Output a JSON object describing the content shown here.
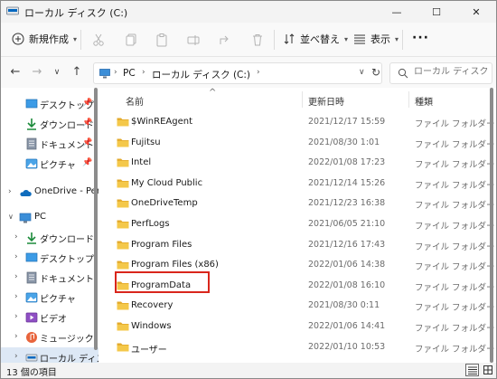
{
  "window": {
    "title": "ローカル ディスク (C:)",
    "controls": {
      "minimize": "—",
      "maximize": "☐",
      "close": "✕"
    }
  },
  "toolbar": {
    "new_label": "新規作成",
    "sort_label": "並べ替え",
    "view_label": "表示",
    "more_label": "···"
  },
  "address": {
    "segments": [
      "PC",
      "ローカル ディスク (C:)"
    ],
    "search_placeholder": "ローカル ディスク (C:)..."
  },
  "sidebar": {
    "items": [
      {
        "label": "デスクトップ",
        "icon": "desktop-icon",
        "pinned": true
      },
      {
        "label": "ダウンロード",
        "icon": "download-icon",
        "pinned": true
      },
      {
        "label": "ドキュメント",
        "icon": "documents-icon",
        "pinned": true
      },
      {
        "label": "ピクチャ",
        "icon": "pictures-icon",
        "pinned": true
      },
      {
        "label": "OneDrive - Perso",
        "icon": "onedrive-icon"
      },
      {
        "label": "PC",
        "icon": "pc-icon"
      },
      {
        "label": "ダウンロード",
        "icon": "download-icon"
      },
      {
        "label": "デスクトップ",
        "icon": "desktop-icon"
      },
      {
        "label": "ドキュメント",
        "icon": "documents-icon"
      },
      {
        "label": "ピクチャ",
        "icon": "pictures-icon"
      },
      {
        "label": "ビデオ",
        "icon": "videos-icon"
      },
      {
        "label": "ミュージック",
        "icon": "music-icon"
      },
      {
        "label": "ローカル ディスク",
        "icon": "drive-icon"
      }
    ]
  },
  "columns": {
    "name": "名前",
    "date": "更新日時",
    "type": "種類"
  },
  "files": [
    {
      "name": "$WinREAgent",
      "date": "2021/12/17 15:59",
      "type": "ファイル フォルダー"
    },
    {
      "name": "Fujitsu",
      "date": "2021/08/30 1:01",
      "type": "ファイル フォルダー"
    },
    {
      "name": "Intel",
      "date": "2022/01/08 17:23",
      "type": "ファイル フォルダー"
    },
    {
      "name": "My Cloud Public",
      "date": "2021/12/14 15:26",
      "type": "ファイル フォルダー"
    },
    {
      "name": "OneDriveTemp",
      "date": "2021/12/23 16:38",
      "type": "ファイル フォルダー"
    },
    {
      "name": "PerfLogs",
      "date": "2021/06/05 21:10",
      "type": "ファイル フォルダー"
    },
    {
      "name": "Program Files",
      "date": "2021/12/16 17:43",
      "type": "ファイル フォルダー"
    },
    {
      "name": "Program Files (x86)",
      "date": "2022/01/06 14:38",
      "type": "ファイル フォルダー"
    },
    {
      "name": "ProgramData",
      "date": "2022/01/08 16:10",
      "type": "ファイル フォルダー"
    },
    {
      "name": "Recovery",
      "date": "2021/08/30 0:11",
      "type": "ファイル フォルダー"
    },
    {
      "name": "Windows",
      "date": "2022/01/06 14:41",
      "type": "ファイル フォルダー"
    },
    {
      "name": "ユーザー",
      "date": "2022/01/10 10:53",
      "type": "ファイル フォルダー"
    }
  ],
  "status": {
    "count": "13 個の項目"
  },
  "colors": {
    "folder": "#f4c84a",
    "folder_dark": "#e3a92b",
    "highlight": "#d9261c",
    "accent": "#0067c0"
  }
}
